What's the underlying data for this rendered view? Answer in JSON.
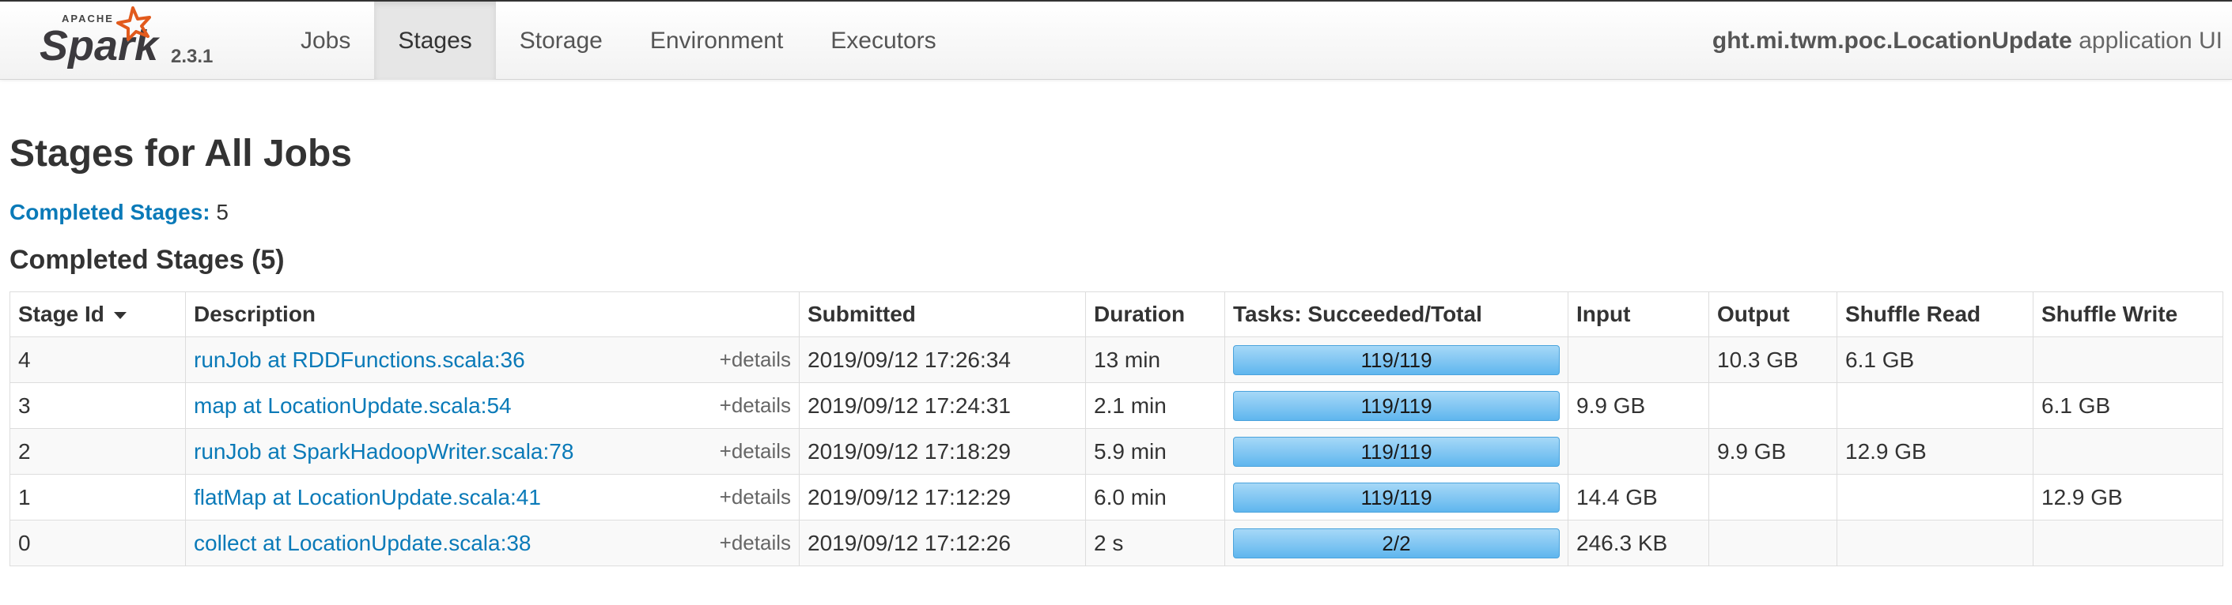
{
  "brand": {
    "name": "Spark",
    "apache": "APACHE",
    "version": "2.3.1"
  },
  "nav": {
    "tabs": [
      {
        "label": "Jobs",
        "active": false
      },
      {
        "label": "Stages",
        "active": true
      },
      {
        "label": "Storage",
        "active": false
      },
      {
        "label": "Environment",
        "active": false
      },
      {
        "label": "Executors",
        "active": false
      }
    ],
    "app_name": "ght.mi.twm.poc.LocationUpdate",
    "app_suffix": "application UI"
  },
  "page": {
    "title": "Stages for All Jobs",
    "summary_label": "Completed Stages:",
    "summary_value": "5",
    "section_title": "Completed Stages (5)"
  },
  "table": {
    "columns": [
      "Stage Id",
      "Description",
      "Submitted",
      "Duration",
      "Tasks: Succeeded/Total",
      "Input",
      "Output",
      "Shuffle Read",
      "Shuffle Write"
    ],
    "details_label": "+details",
    "rows": [
      {
        "id": "4",
        "desc": "runJob at RDDFunctions.scala:36",
        "submitted": "2019/09/12 17:26:34",
        "duration": "13 min",
        "tasks": "119/119",
        "progress": 1.0,
        "input": "",
        "output": "10.3 GB",
        "shuffle_read": "6.1 GB",
        "shuffle_write": ""
      },
      {
        "id": "3",
        "desc": "map at LocationUpdate.scala:54",
        "submitted": "2019/09/12 17:24:31",
        "duration": "2.1 min",
        "tasks": "119/119",
        "progress": 1.0,
        "input": "9.9 GB",
        "output": "",
        "shuffle_read": "",
        "shuffle_write": "6.1 GB"
      },
      {
        "id": "2",
        "desc": "runJob at SparkHadoopWriter.scala:78",
        "submitted": "2019/09/12 17:18:29",
        "duration": "5.9 min",
        "tasks": "119/119",
        "progress": 1.0,
        "input": "",
        "output": "9.9 GB",
        "shuffle_read": "12.9 GB",
        "shuffle_write": ""
      },
      {
        "id": "1",
        "desc": "flatMap at LocationUpdate.scala:41",
        "submitted": "2019/09/12 17:12:29",
        "duration": "6.0 min",
        "tasks": "119/119",
        "progress": 1.0,
        "input": "14.4 GB",
        "output": "",
        "shuffle_read": "",
        "shuffle_write": "12.9 GB"
      },
      {
        "id": "0",
        "desc": "collect at LocationUpdate.scala:38",
        "submitted": "2019/09/12 17:12:26",
        "duration": "2 s",
        "tasks": "2/2",
        "progress": 1.0,
        "input": "246.3 KB",
        "output": "",
        "shuffle_read": "",
        "shuffle_write": ""
      }
    ]
  },
  "colors": {
    "link": "#0a7ab8",
    "progress": "#5fb6ee",
    "logo_orange": "#e25a1c"
  }
}
